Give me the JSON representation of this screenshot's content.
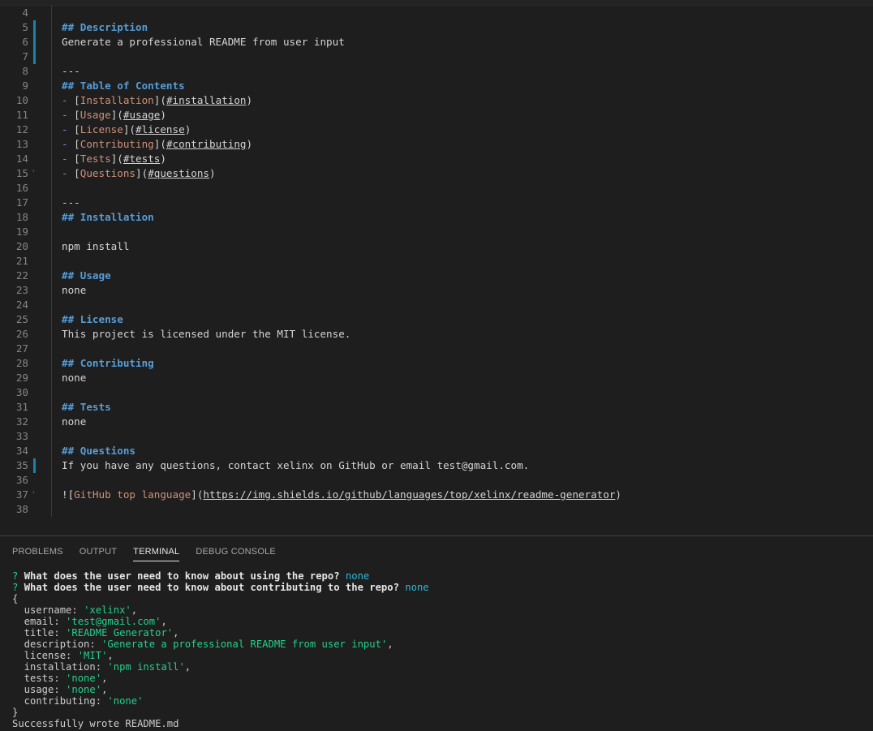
{
  "editor": {
    "lines": [
      {
        "n": "4",
        "text": ""
      },
      {
        "n": "5",
        "kind": "heading",
        "hash": "## ",
        "text": "Description"
      },
      {
        "n": "6",
        "text": "Generate a professional README from user input"
      },
      {
        "n": "7",
        "text": ""
      },
      {
        "n": "8",
        "text": "---"
      },
      {
        "n": "9",
        "kind": "heading",
        "hash": "## ",
        "text": "Table of Contents"
      },
      {
        "n": "10",
        "kind": "toc",
        "label": "Installation",
        "anchor": "#installation"
      },
      {
        "n": "11",
        "kind": "toc",
        "label": "Usage",
        "anchor": "#usage"
      },
      {
        "n": "12",
        "kind": "toc",
        "label": "License",
        "anchor": "#license"
      },
      {
        "n": "13",
        "kind": "toc",
        "label": "Contributing",
        "anchor": "#contributing"
      },
      {
        "n": "14",
        "kind": "toc",
        "label": "Tests",
        "anchor": "#tests"
      },
      {
        "n": "15",
        "kind": "toc",
        "label": "Questions",
        "anchor": "#questions"
      },
      {
        "n": "16",
        "text": ""
      },
      {
        "n": "17",
        "text": "---"
      },
      {
        "n": "18",
        "kind": "heading",
        "hash": "## ",
        "text": "Installation"
      },
      {
        "n": "19",
        "text": ""
      },
      {
        "n": "20",
        "text": "npm install"
      },
      {
        "n": "21",
        "text": ""
      },
      {
        "n": "22",
        "kind": "heading",
        "hash": "## ",
        "text": "Usage"
      },
      {
        "n": "23",
        "text": "none"
      },
      {
        "n": "24",
        "text": ""
      },
      {
        "n": "25",
        "kind": "heading",
        "hash": "## ",
        "text": "License"
      },
      {
        "n": "26",
        "text": "This project is licensed under the MIT license."
      },
      {
        "n": "27",
        "text": ""
      },
      {
        "n": "28",
        "kind": "heading",
        "hash": "## ",
        "text": "Contributing"
      },
      {
        "n": "29",
        "text": "none"
      },
      {
        "n": "30",
        "text": ""
      },
      {
        "n": "31",
        "kind": "heading",
        "hash": "## ",
        "text": "Tests"
      },
      {
        "n": "32",
        "text": "none"
      },
      {
        "n": "33",
        "text": ""
      },
      {
        "n": "34",
        "kind": "heading",
        "hash": "## ",
        "text": "Questions"
      },
      {
        "n": "35",
        "text": "If you have any questions, contact xelinx on GitHub or email test@gmail.com."
      },
      {
        "n": "36",
        "text": ""
      },
      {
        "n": "37",
        "kind": "image",
        "alt": "GitHub top language",
        "url": "https://img.shields.io/github/languages/top/xelinx/readme-generator"
      },
      {
        "n": "38",
        "text": ""
      }
    ]
  },
  "panel": {
    "tabs": [
      {
        "label": "PROBLEMS",
        "active": false
      },
      {
        "label": "OUTPUT",
        "active": false
      },
      {
        "label": "TERMINAL",
        "active": true
      },
      {
        "label": "DEBUG CONSOLE",
        "active": false
      }
    ]
  },
  "terminal": {
    "prompts": [
      {
        "mark": "?",
        "question": "What does the user need to know about using the repo?",
        "answer": "none"
      },
      {
        "mark": "?",
        "question": "What does the user need to know about contributing to the repo?",
        "answer": "none"
      }
    ],
    "open_brace": "{",
    "fields": [
      {
        "key": "username",
        "value": "'xelinx'",
        "comma": ","
      },
      {
        "key": "email",
        "value": "'test@gmail.com'",
        "comma": ","
      },
      {
        "key": "title",
        "value": "'README Generator'",
        "comma": ","
      },
      {
        "key": "description",
        "value": "'Generate a professional README from user input'",
        "comma": ","
      },
      {
        "key": "license",
        "value": "'MIT'",
        "comma": ","
      },
      {
        "key": "installation",
        "value": "'npm install'",
        "comma": ","
      },
      {
        "key": "tests",
        "value": "'none'",
        "comma": ","
      },
      {
        "key": "usage",
        "value": "'none'",
        "comma": ","
      },
      {
        "key": "contributing",
        "value": "'none'",
        "comma": ""
      }
    ],
    "close_brace": "}",
    "final_message": "Successfully wrote README.md"
  },
  "colors": {
    "heading": "#569cd6",
    "link_text": "#ce9178",
    "terminal_string": "#23d18b",
    "terminal_answer": "#29b8db",
    "gutter_modified": "#1b81a8"
  }
}
